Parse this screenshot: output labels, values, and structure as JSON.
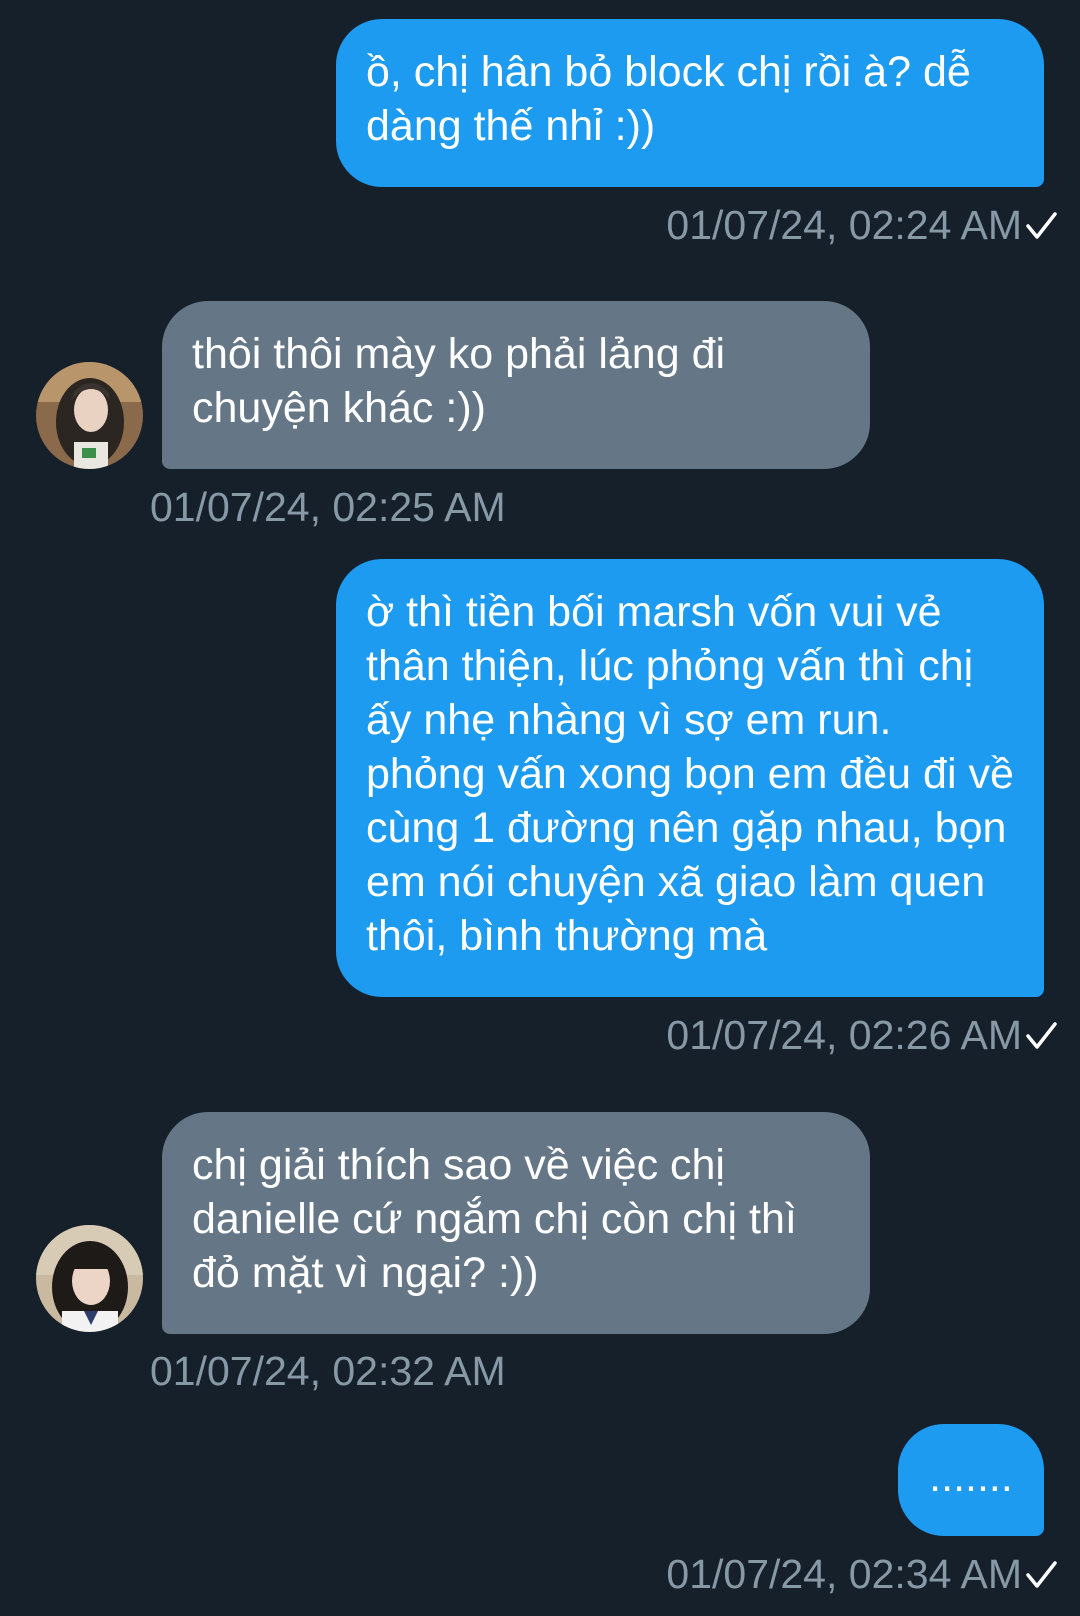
{
  "messages": [
    {
      "direction": "out",
      "text": "ồ, chị hân bỏ block chị rồi à? dễ dàng thế nhỉ :))",
      "time": "01/07/24, 02:24 AM",
      "read": true
    },
    {
      "direction": "in",
      "text": "thôi thôi mày ko phải lảng đi chuyện khác :))",
      "time": "01/07/24, 02:25 AM",
      "avatar": "avatar-photo-1"
    },
    {
      "direction": "out",
      "text": "ờ thì tiền bối marsh vốn vui vẻ thân thiện, lúc phỏng vấn thì chị ấy nhẹ nhàng vì sợ em run. phỏng vấn xong bọn em đều đi về cùng 1 đường nên gặp nhau, bọn em nói chuyện xã giao làm quen thôi, bình thường mà",
      "time": "01/07/24, 02:26 AM",
      "read": true
    },
    {
      "direction": "in",
      "text": "chị giải thích sao về việc chị danielle cứ ngắm chị còn chị thì đỏ mặt vì ngại? :))",
      "time": "01/07/24, 02:32 AM",
      "avatar": "avatar-photo-2"
    },
    {
      "direction": "out",
      "text": ".......",
      "time": "01/07/24, 02:34 AM",
      "read": true
    }
  ],
  "colors": {
    "background": "#16202b",
    "outgoing_bubble": "#1d9bf0",
    "incoming_bubble": "#657786",
    "timestamp": "#8899a6",
    "check": "#ffffff"
  },
  "icons": {
    "read_receipt": "checkmark-icon"
  }
}
